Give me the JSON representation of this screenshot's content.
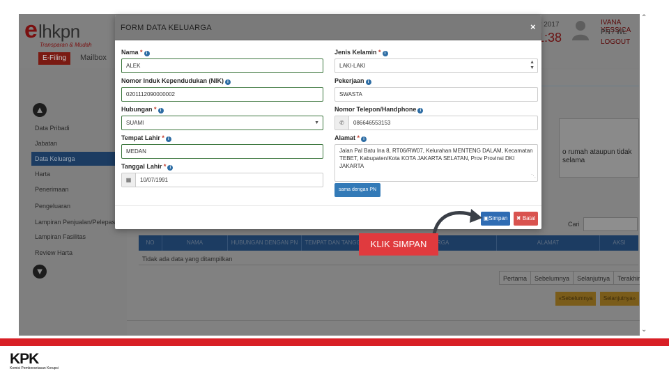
{
  "app": {
    "logo_text": "lhkpn",
    "logo_letter": "e",
    "logo_tagline": "Transparan & Mudah",
    "nav_efiling": "E-Filing",
    "nav_mailbox": "Mailbox",
    "date_label": "ber 2017",
    "clock": "41:38",
    "user_name": "IVANA YESSICA",
    "user_role": "PN / WL",
    "logout": "LOGOUT"
  },
  "sidebar": {
    "items": [
      {
        "label": "Data Pribadi"
      },
      {
        "label": "Jabatan"
      },
      {
        "label": "Data Keluarga"
      },
      {
        "label": "Harta"
      },
      {
        "label": "Penerimaan"
      },
      {
        "label": "Pengeluaran"
      },
      {
        "label": "Lampiran Penjualan/Pelepasan"
      },
      {
        "label": "Lampiran Fasilitas"
      },
      {
        "label": "Review Harta"
      }
    ]
  },
  "notice_text": "o rumah ataupun tidak selama",
  "search": {
    "label": "Cari"
  },
  "table": {
    "headers": [
      "NO",
      "NAMA",
      "HUBUNGAN DENGAN PN",
      "TEMPAT DAN TANGGAL",
      "KELUARGA",
      "ALAMAT",
      "AKSI"
    ],
    "empty_text": "Tidak ada data yang ditampilkan"
  },
  "pager": [
    "Pertama",
    "Sebelumnya",
    "Selanjutnya",
    "Terakhir"
  ],
  "nav_buttons": {
    "prev": "«Sebelumnya",
    "next": "Selanjutnya»"
  },
  "modal": {
    "title": "FORM DATA KELUARGA",
    "close": "×",
    "fields": {
      "nama": {
        "label": "Nama",
        "value": "ALEK"
      },
      "nik": {
        "label": "Nomor Induk Kependudukan (NIK)",
        "value": "0201112090000002"
      },
      "hubungan": {
        "label": "Hubungan",
        "value": "SUAMI"
      },
      "tempat_lahir": {
        "label": "Tempat Lahir",
        "value": "MEDAN"
      },
      "tanggal_lahir": {
        "label": "Tanggal Lahir",
        "value": "10/07/1991"
      },
      "jenis_kelamin": {
        "label": "Jenis Kelamin",
        "value": "LAKI-LAKI"
      },
      "pekerjaan": {
        "label": "Pekerjaan",
        "value": "SWASTA"
      },
      "telepon": {
        "label": "Nomor Telepon/Handphone",
        "value": "086646553153"
      },
      "alamat": {
        "label": "Alamat",
        "value": "Jalan Pal Batu Ina 8, RT06/RW07, Kelurahan MENTENG DALAM, Kecamatan TEBET, Kabupaten/Kota KOTA JAKARTA SELATAN, Prov Provinsi DKI JAKARTA"
      }
    },
    "same_button": "sama dengan PN",
    "save_button": "Simpan",
    "cancel_button": "Batal"
  },
  "callout": {
    "text": "KLIK SIMPAN"
  },
  "footer": {
    "logo": "KPK",
    "subtitle": "Komisi Pemberantasan Korupsi"
  },
  "colors": {
    "accent_red": "#e03a3e",
    "primary_blue": "#2f6cb3",
    "danger": "#d9534f",
    "footer_bar": "#d81f26"
  }
}
